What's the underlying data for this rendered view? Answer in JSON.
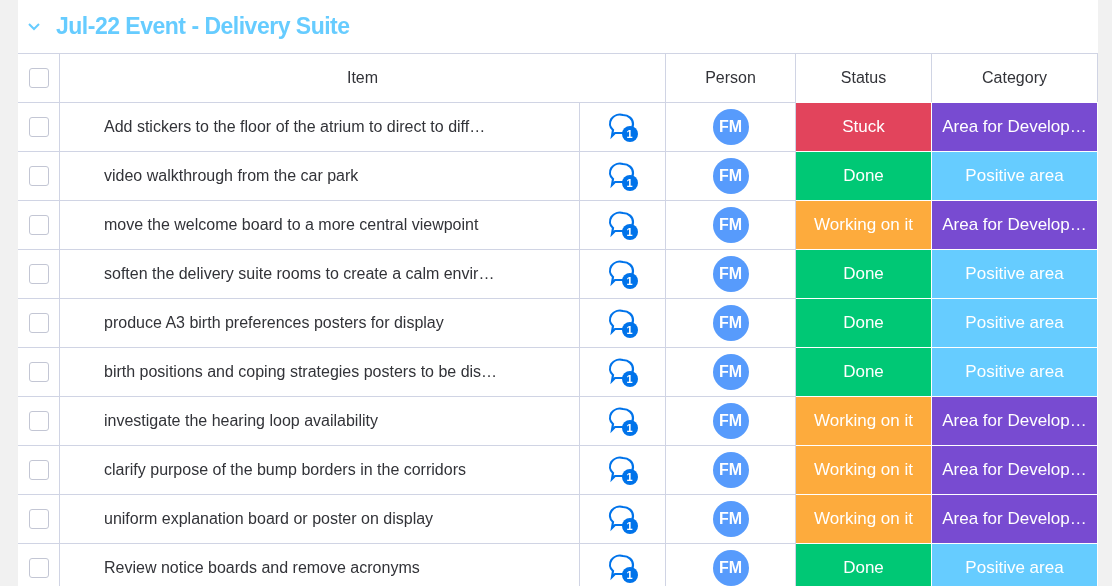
{
  "group": {
    "title": "Jul-22 Event - Delivery Suite",
    "expanded": true
  },
  "columns": [
    "Item",
    "Person",
    "Status",
    "Category"
  ],
  "header_checked": false,
  "rows": [
    {
      "checked": false,
      "item": "Add stickers to the floor of the atrium to direct to diff…",
      "updates": "1",
      "person": "FM",
      "status": {
        "label": "Stuck",
        "color": "#e2445c"
      },
      "category": {
        "label": "Area for Develop…",
        "color": "#784bd1"
      }
    },
    {
      "checked": false,
      "item": "video walkthrough from the car park",
      "updates": "1",
      "person": "FM",
      "status": {
        "label": "Done",
        "color": "#00c875"
      },
      "category": {
        "label": "Positive area",
        "color": "#66ccff"
      }
    },
    {
      "checked": false,
      "item": "move the welcome board to a more central viewpoint",
      "updates": "1",
      "person": "FM",
      "status": {
        "label": "Working on it",
        "color": "#fdab3d"
      },
      "category": {
        "label": "Area for Develop…",
        "color": "#784bd1"
      }
    },
    {
      "checked": false,
      "item": "soften the delivery suite rooms to create a calm envir…",
      "updates": "1",
      "person": "FM",
      "status": {
        "label": "Done",
        "color": "#00c875"
      },
      "category": {
        "label": "Positive area",
        "color": "#66ccff"
      }
    },
    {
      "checked": false,
      "item": "produce A3 birth preferences posters for display",
      "updates": "1",
      "person": "FM",
      "status": {
        "label": "Done",
        "color": "#00c875"
      },
      "category": {
        "label": "Positive area",
        "color": "#66ccff"
      }
    },
    {
      "checked": false,
      "item": "birth positions and coping strategies posters to be dis…",
      "updates": "1",
      "person": "FM",
      "status": {
        "label": "Done",
        "color": "#00c875"
      },
      "category": {
        "label": "Positive area",
        "color": "#66ccff"
      }
    },
    {
      "checked": false,
      "item": "investigate the hearing loop availability",
      "updates": "1",
      "person": "FM",
      "status": {
        "label": "Working on it",
        "color": "#fdab3d"
      },
      "category": {
        "label": "Area for Develop…",
        "color": "#784bd1"
      }
    },
    {
      "checked": false,
      "item": "clarify purpose of the bump borders in the corridors",
      "updates": "1",
      "person": "FM",
      "status": {
        "label": "Working on it",
        "color": "#fdab3d"
      },
      "category": {
        "label": "Area for Develop…",
        "color": "#784bd1"
      }
    },
    {
      "checked": false,
      "item": "uniform explanation board or poster on display",
      "updates": "1",
      "person": "FM",
      "status": {
        "label": "Working on it",
        "color": "#fdab3d"
      },
      "category": {
        "label": "Area for Develop…",
        "color": "#784bd1"
      }
    },
    {
      "checked": false,
      "item": "Review notice boards and remove acronyms",
      "updates": "1",
      "person": "FM",
      "status": {
        "label": "Done",
        "color": "#00c875"
      },
      "category": {
        "label": "Positive area",
        "color": "#66ccff"
      }
    }
  ]
}
